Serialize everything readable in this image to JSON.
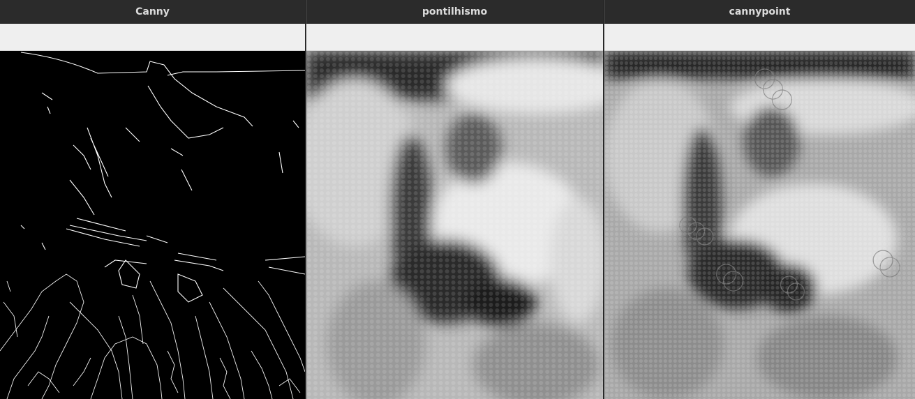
{
  "windows": [
    {
      "title": "Canny"
    },
    {
      "title": "pontilhismo"
    },
    {
      "title": "cannypoint"
    }
  ]
}
